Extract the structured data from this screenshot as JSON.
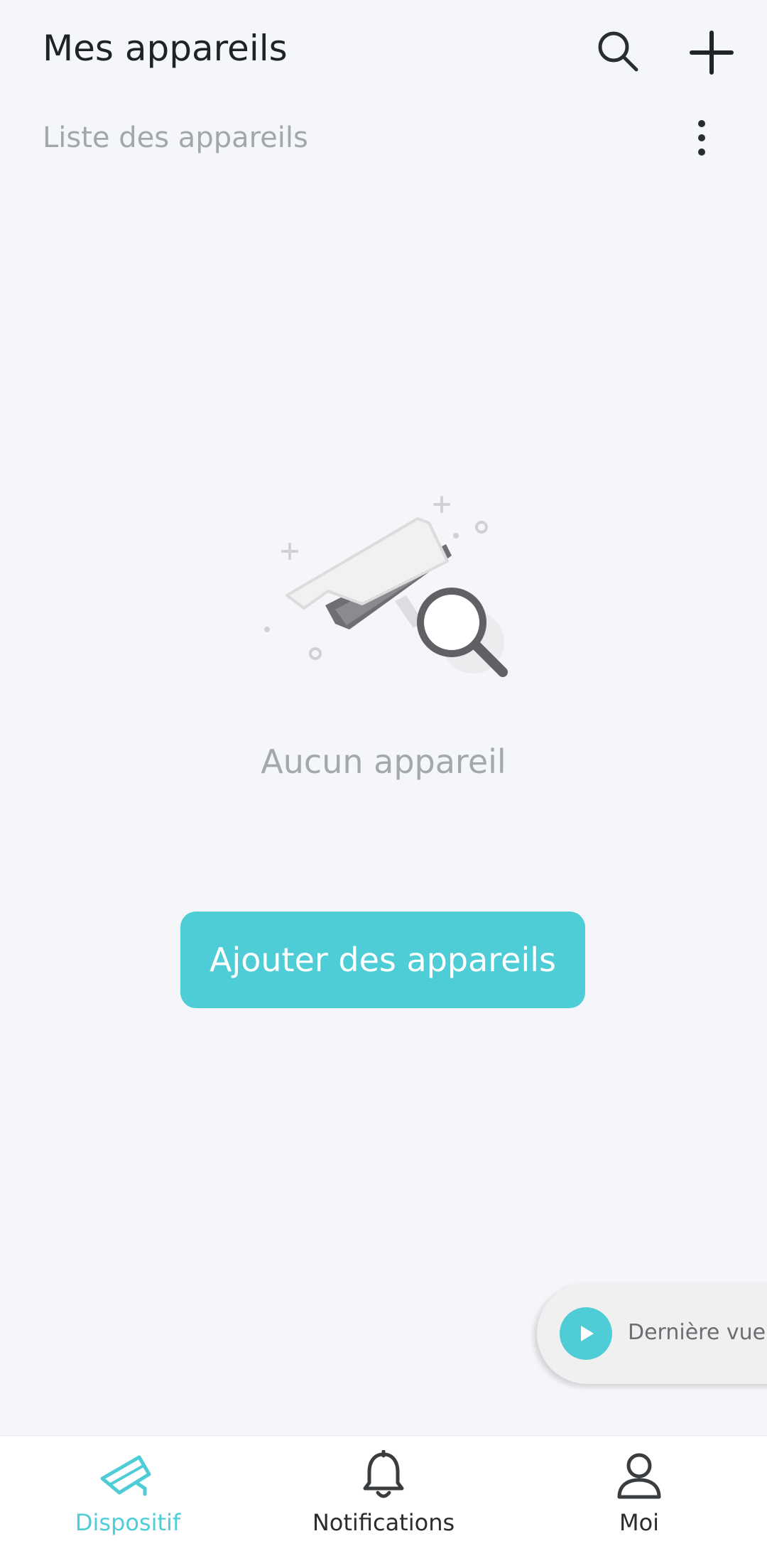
{
  "header": {
    "title": "Mes appareils",
    "search_icon": "search-icon",
    "add_icon": "plus-icon"
  },
  "subheader": {
    "label": "Liste des appareils",
    "more_icon": "more-vertical-icon"
  },
  "empty_state": {
    "illustration": "camera-search-illustration",
    "text": "Aucun appareil",
    "button_label": "Ajouter des appareils"
  },
  "last_view": {
    "label": "Dernière vue",
    "icon": "play-icon"
  },
  "bottom_nav": {
    "items": [
      {
        "label": "Dispositif",
        "icon": "camera-icon",
        "active": true
      },
      {
        "label": "Notifications",
        "icon": "bell-icon",
        "active": false
      },
      {
        "label": "Moi",
        "icon": "user-icon",
        "active": false
      }
    ]
  },
  "colors": {
    "accent": "#4ecdd6",
    "background": "#f5f6fa",
    "title_text": "#1f2226",
    "muted_text": "#a3a6ab"
  }
}
